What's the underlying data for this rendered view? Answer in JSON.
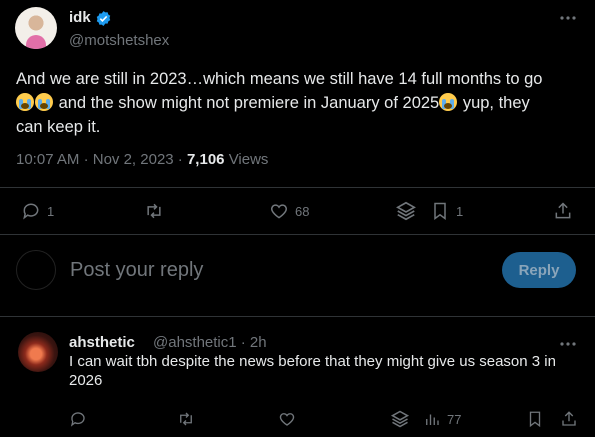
{
  "tweet": {
    "display_name": "idk",
    "handle": "@motshetshex",
    "text_line1": "And we are still in 2023…which means we still have 14 full months to go",
    "text_line2_after_emoji": " and the show might not premiere in January of 2025",
    "text_line2_end": " yup, they",
    "text_line3": "can keep it.",
    "time": "10:07 AM",
    "date": "Nov 2, 2023",
    "views_count": "7,106",
    "views_label": "Views",
    "emoji_icon": "loudly-crying-face-icon",
    "actions": {
      "replies": "1",
      "likes": "68",
      "bookmarks": "1"
    }
  },
  "composer": {
    "placeholder": "Post your reply",
    "button_label": "Reply"
  },
  "reply": {
    "display_name": "ahsthetic",
    "handle_time": "@ahsthetic1 · 2h",
    "text": "I can wait tbh despite the news before that they might give us season 3 in 2026",
    "views": "77"
  },
  "colors": {
    "background": "#000000",
    "text": "#e7e9ea",
    "muted": "#71767b",
    "verified": "#1d9bf0",
    "reply_button": "#1d5f8f"
  }
}
